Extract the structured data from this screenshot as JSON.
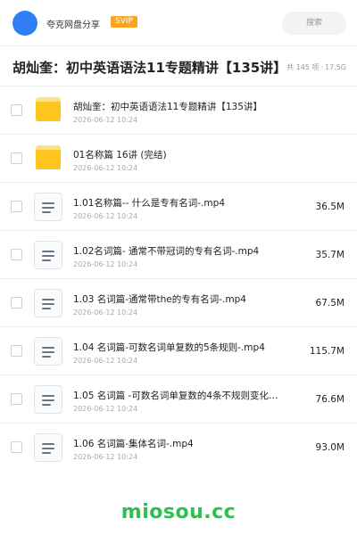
{
  "header": {
    "app_name": "夸克网盘分享",
    "badge": "SVIP",
    "search_placeholder": "搜索"
  },
  "title_bar": {
    "title": "胡灿奎：初中英语语法11专题精讲【135讲】",
    "count": "共 145 项",
    "separator": "·",
    "total_size": "17.5G"
  },
  "files": [
    {
      "type": "folder",
      "name": "胡灿奎：初中英语语法11专题精讲【135讲】",
      "date": "2026-06-12 10:24",
      "size": ""
    },
    {
      "type": "folder",
      "name": "01名称篇  16讲 (完结)",
      "date": "2026-06-12 10:24",
      "size": ""
    },
    {
      "type": "file",
      "name": "1.01名称篇-- 什么是专有名词-.mp4",
      "date": "2026-06-12 10:24",
      "size": "36.5M"
    },
    {
      "type": "file",
      "name": "1.02名词篇- 通常不带冠词的专有名词-.mp4",
      "date": "2026-06-12 10:24",
      "size": "35.7M"
    },
    {
      "type": "file",
      "name": "1.03 名词篇-通常带the的专有名词-.mp4",
      "date": "2026-06-12 10:24",
      "size": "67.5M"
    },
    {
      "type": "file",
      "name": "1.04 名词篇-可数名词单复数的5条规则-.mp4",
      "date": "2026-06-12 10:24",
      "size": "115.7M"
    },
    {
      "type": "file",
      "name": "1.05 名词篇 -可数名词单复数的4条不规则变化…",
      "date": "2026-06-12 10:24",
      "size": "76.6M"
    },
    {
      "type": "file",
      "name": "1.06 名词篇-集体名词-.mp4",
      "date": "2026-06-12 10:24",
      "size": "93.0M"
    }
  ],
  "watermark": "miosou.cc",
  "colors": {
    "avatar": "#2f7ef5",
    "badge": "#f6a623",
    "folder": "#ffc51f",
    "watermark": "#2fbf4f"
  }
}
